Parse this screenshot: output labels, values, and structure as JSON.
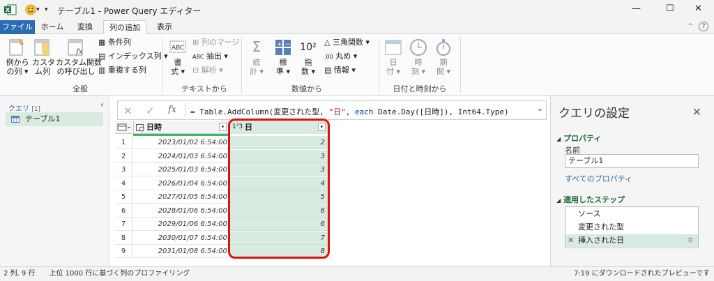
{
  "window": {
    "title": "テーブル1 - Power Query エディター",
    "minimize": "—",
    "maximize": "☐",
    "close": "✕"
  },
  "tabs": [
    "ファイル",
    "ホーム",
    "変換",
    "列の追加",
    "表示"
  ],
  "ribbon": {
    "general": {
      "btn1": "例から\nの列 ▾",
      "btn2": "カスタ\nム列",
      "btn3": "カスタム関数\nの呼び出し",
      "cond": "条件列",
      "index": "インデックス列 ▾",
      "dup": "重複する列",
      "label": "全般"
    },
    "text": {
      "format": "書\n式 ▾",
      "merge": "列のマージ",
      "extract": "抽出 ▾",
      "parse": "解析 ▾",
      "label": "テキストから"
    },
    "number": {
      "stat": "統\n計 ▾",
      "standard": "標\n準 ▾",
      "sci": "指\n数 ▾",
      "trig": "三角関数 ▾",
      "round": "丸め ▾",
      "info": "情報 ▾",
      "label": "数値から"
    },
    "datetime": {
      "date": "日\n付 ▾",
      "time": "時\n刻 ▾",
      "duration": "期\n間 ▾",
      "label": "日付と時刻から"
    }
  },
  "queries": {
    "header": "クエリ",
    "count": "[1]",
    "items": [
      "テーブル1"
    ]
  },
  "formula": {
    "eq": "= Table.AddColumn(変更された型, ",
    "str": "\"日\"",
    "mid": ", ",
    "kw": "each",
    "rest": " Date.Day([日時]), Int64.Type)"
  },
  "grid": {
    "columns": [
      {
        "name": "日時",
        "type": "datetime"
      },
      {
        "name": "日",
        "type": "1²3"
      }
    ],
    "rows": [
      [
        "2023/01/02 6:54:00",
        "2"
      ],
      [
        "2024/01/03 6:54:00",
        "3"
      ],
      [
        "2025/01/03 6:54:00",
        "3"
      ],
      [
        "2026/01/04 6:54:00",
        "4"
      ],
      [
        "2027/01/05 6:54:00",
        "5"
      ],
      [
        "2028/01/06 6:54:00",
        "6"
      ],
      [
        "2029/01/06 6:54:00",
        "6"
      ],
      [
        "2030/01/07 6:54:00",
        "7"
      ],
      [
        "2031/01/08 6:54:00",
        "8"
      ]
    ]
  },
  "settings": {
    "title": "クエリの設定",
    "props": "プロパティ",
    "name_label": "名前",
    "name_value": "テーブル1",
    "all_props": "すべてのプロパティ",
    "steps_label": "適用したステップ",
    "steps": [
      "ソース",
      "変更された型",
      "挿入された日"
    ]
  },
  "status": {
    "left": "2 列, 9 行　　上位 1000 行に基づく列のプロファイリング",
    "right": "7:19 にダウンロードされたプレビューです"
  },
  "colors": {
    "accent": "#2b6cb3",
    "selection": "#d7ebe0",
    "highlight": "#e01010",
    "excel": "#1e7145"
  }
}
